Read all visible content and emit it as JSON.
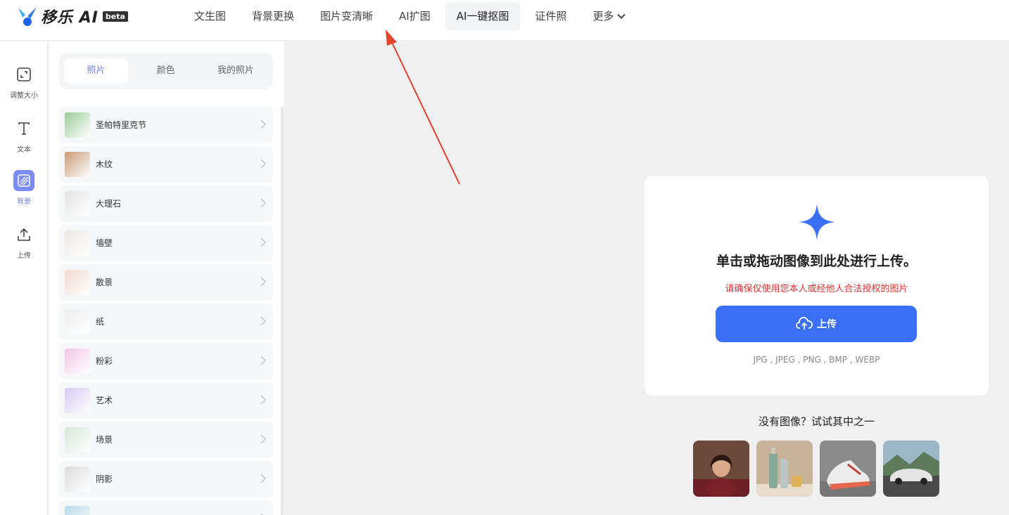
{
  "logo": {
    "text": "移乐 AI",
    "badge": "beta"
  },
  "nav": {
    "items": [
      "文生图",
      "背景更换",
      "图片变清晰",
      "AI扩图",
      "AI一键抠图",
      "证件照"
    ],
    "more": "更多",
    "active_index": 4
  },
  "rail": {
    "items": [
      {
        "label": "调整大小",
        "icon": "resize-icon"
      },
      {
        "label": "文本",
        "icon": "text-icon"
      },
      {
        "label": "背景",
        "icon": "background-icon",
        "active": true
      },
      {
        "label": "上传",
        "icon": "upload-icon"
      }
    ]
  },
  "panel": {
    "tabs": [
      "照片",
      "颜色",
      "我的照片"
    ],
    "active_tab": 0,
    "categories": [
      {
        "label": "圣帕特里克节",
        "color": "#9ccc9a"
      },
      {
        "label": "木纹",
        "color": "#c99b76"
      },
      {
        "label": "大理石",
        "color": "#e4e4e4"
      },
      {
        "label": "墙壁",
        "color": "#ece9e3"
      },
      {
        "label": "散景",
        "color": "#f2d9cf"
      },
      {
        "label": "纸",
        "color": "#eeeeee"
      },
      {
        "label": "粉彩",
        "color": "#f2c6e8"
      },
      {
        "label": "艺术",
        "color": "#d9c9f3"
      },
      {
        "label": "场景",
        "color": "#d4e8d6"
      },
      {
        "label": "阴影",
        "color": "#dcdcdc"
      },
      {
        "label": "",
        "color": "#b8d9ec"
      }
    ]
  },
  "upload": {
    "title": "单击或拖动图像到此处进行上传。",
    "warning": "请确保仅使用您本人或经他人合法授权的图片",
    "button": "上传",
    "formats": "JPG , JPEG , PNG , BMP , WEBP"
  },
  "samples": {
    "title": "没有图像？试试其中之一",
    "items": [
      "sample-portrait",
      "sample-bottles",
      "sample-sneaker",
      "sample-car"
    ]
  },
  "colors": {
    "accent": "#3a6ff7",
    "rail_active": "#7b8cf5",
    "warning": "#e0312f"
  }
}
